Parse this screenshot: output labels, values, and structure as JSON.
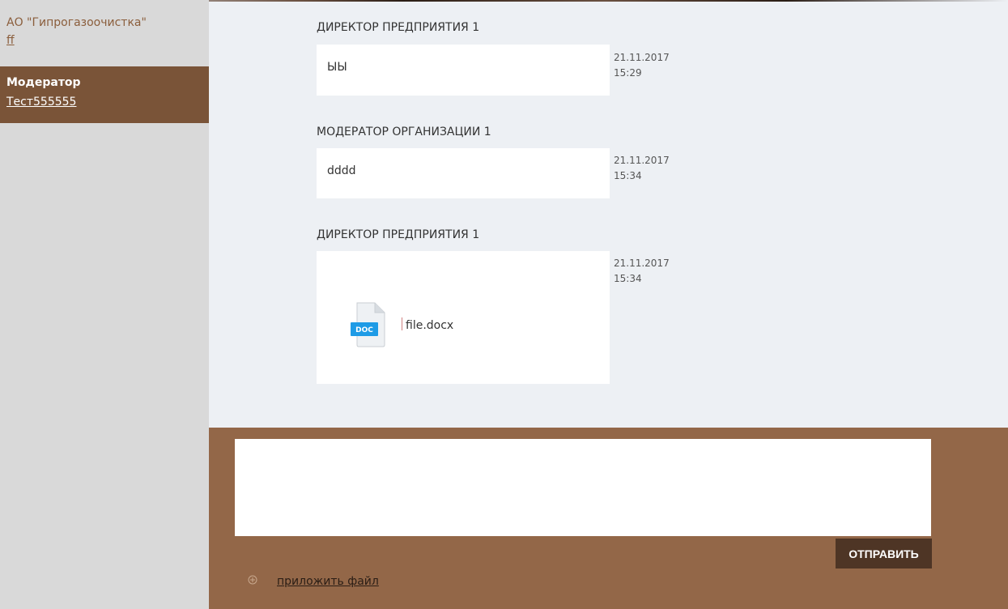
{
  "sidebar": {
    "items": [
      {
        "title": "АО \"Гипрогазоочистка\"",
        "link": "ff",
        "active": false
      },
      {
        "title": "Модератор",
        "link": "Тест555555",
        "active": true
      }
    ]
  },
  "chat": {
    "messages": [
      {
        "author": "ДИРЕКТОР ПРЕДПРИЯТИЯ 1",
        "text": "ЫЫ",
        "date": "21.11.2017",
        "time": "15:29"
      },
      {
        "author": "МОДЕРАТОР ОРГАНИЗАЦИИ 1",
        "text": "dddd",
        "date": "21.11.2017",
        "time": "15:34"
      },
      {
        "author": "ДИРЕКТОР ПРЕДПРИЯТИЯ 1",
        "attachment": {
          "icon": "doc-file-icon",
          "badge": "DOC",
          "name": "file.docx"
        },
        "date": "21.11.2017",
        "time": "15:34"
      }
    ]
  },
  "composer": {
    "placeholder": "",
    "send_label": "ОТПРАВИТЬ",
    "attach_label": "приложить файл",
    "attach_icon": "plus-circle-icon"
  },
  "colors": {
    "sidebar_bg": "#d9d9d9",
    "sidebar_active_bg": "#7a5438",
    "sidebar_text": "#8b5e3c",
    "chat_bg": "#edf0f4",
    "composer_bg": "#936748",
    "send_button_bg": "#4e3525",
    "doc_badge": "#1e9be6"
  }
}
